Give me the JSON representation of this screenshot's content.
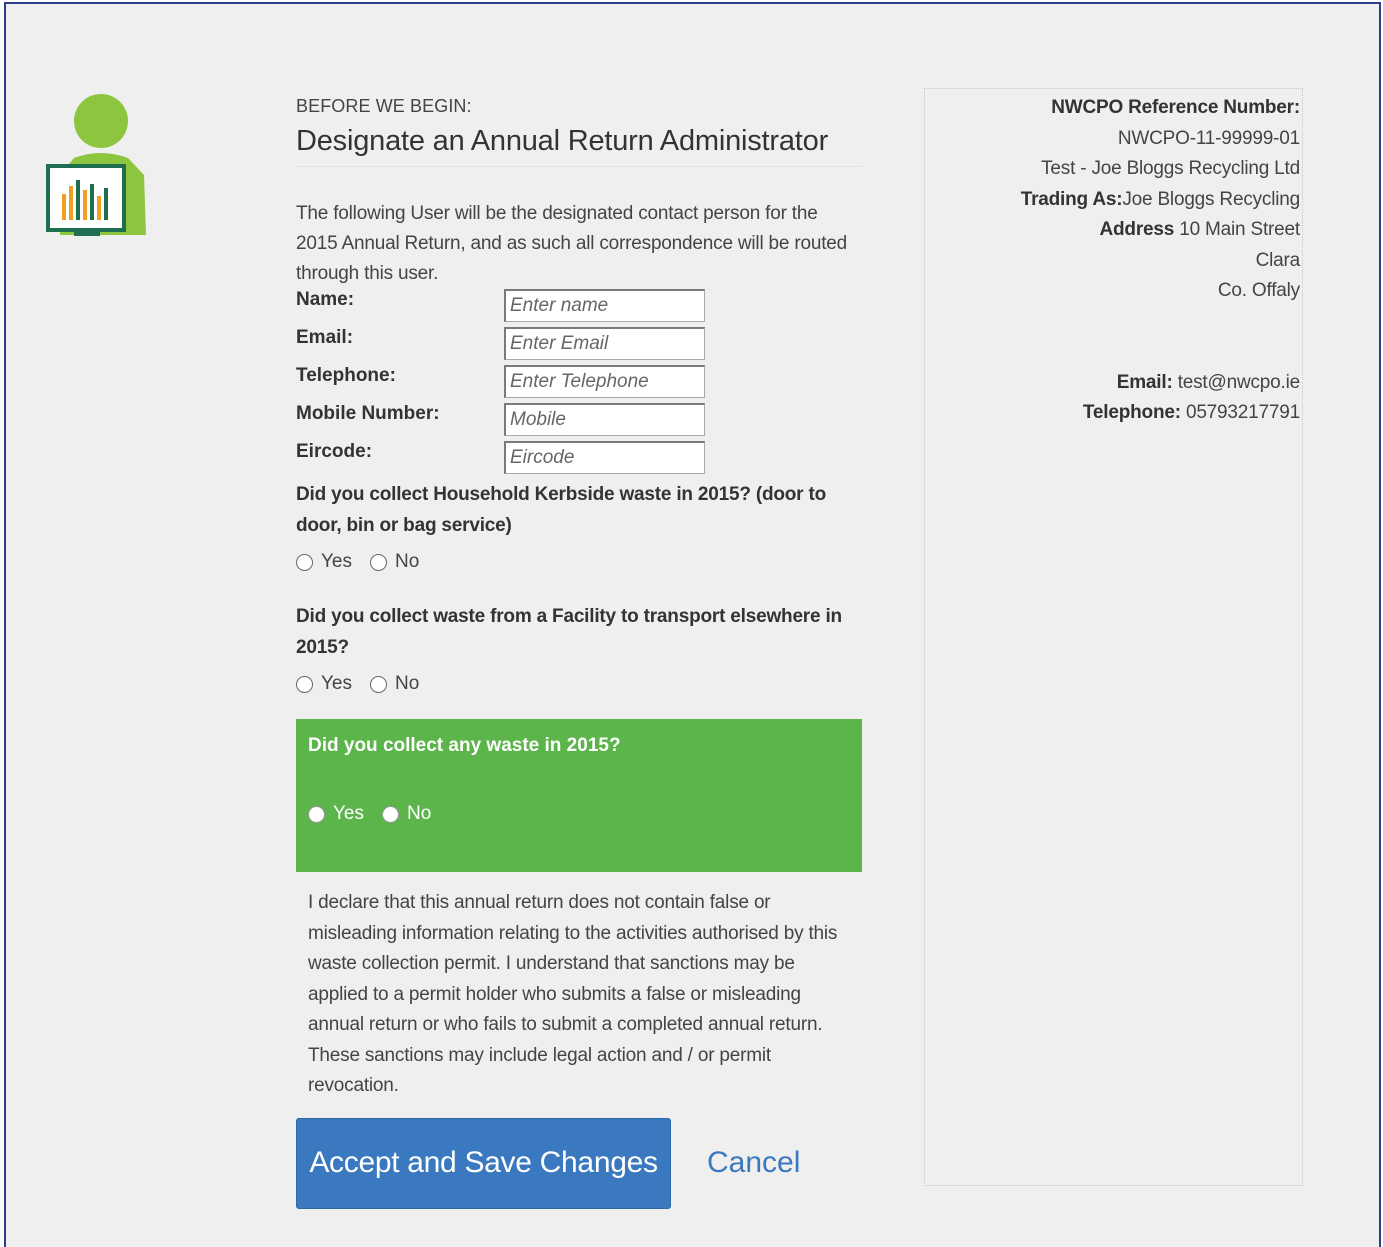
{
  "header": {
    "kicker": "BEFORE WE BEGIN:",
    "title": "Designate an Annual Return Administrator"
  },
  "intro": "The following User will be the designated contact person for the 2015 Annual Return, and as such all correspondence will be routed through this user.",
  "form": {
    "name": {
      "label": "Name:",
      "placeholder": "Enter name",
      "value": ""
    },
    "email": {
      "label": "Email:",
      "placeholder": "Enter Email",
      "value": ""
    },
    "telephone": {
      "label": "Telephone:",
      "placeholder": "Enter Telephone",
      "value": ""
    },
    "mobile": {
      "label": "Mobile Number:",
      "placeholder": "Mobile",
      "value": ""
    },
    "eircode": {
      "label": "Eircode:",
      "placeholder": "Eircode",
      "value": ""
    }
  },
  "questions": {
    "kerbside": {
      "text": "Did you collect Household Kerbside waste in 2015? (door to door, bin or bag service)",
      "yes": "Yes",
      "no": "No"
    },
    "facility": {
      "text": "Did you collect waste from a Facility to transport elsewhere in 2015?",
      "yes": "Yes",
      "no": "No"
    },
    "any_waste": {
      "text": "Did you collect any waste in 2015?",
      "yes": "Yes",
      "no": "No"
    }
  },
  "declaration": "I declare that this annual return does not contain false or misleading information relating to the activities authorised by this waste collection permit. I understand that sanctions may be applied to a permit holder who submits a false or misleading annual return or who fails to submit a completed annual return. These sanctions may include legal action and / or permit revocation.",
  "actions": {
    "accept_label": "Accept and Save Changes",
    "cancel_label": "Cancel"
  },
  "side": {
    "ref_label": "NWCPO Reference Number:",
    "ref_value": "NWCPO-11-99999-01",
    "company": "Test - Joe Bloggs Recycling Ltd",
    "trading_label": "Trading As:",
    "trading_value": "Joe Bloggs Recycling",
    "address_label": "Address",
    "address_line1": "10 Main Street",
    "address_line2": "Clara",
    "address_line3": "Co. Offaly",
    "email_label": "Email:",
    "email_value": "test@nwcpo.ie",
    "telephone_label": "Telephone:",
    "telephone_value": "05793217791"
  },
  "colors": {
    "accent_green": "#5cb54b",
    "primary_blue": "#3a79bf",
    "frame_border": "#2b3f8c"
  },
  "icons": {
    "user": "user-monitor-chart-icon"
  }
}
